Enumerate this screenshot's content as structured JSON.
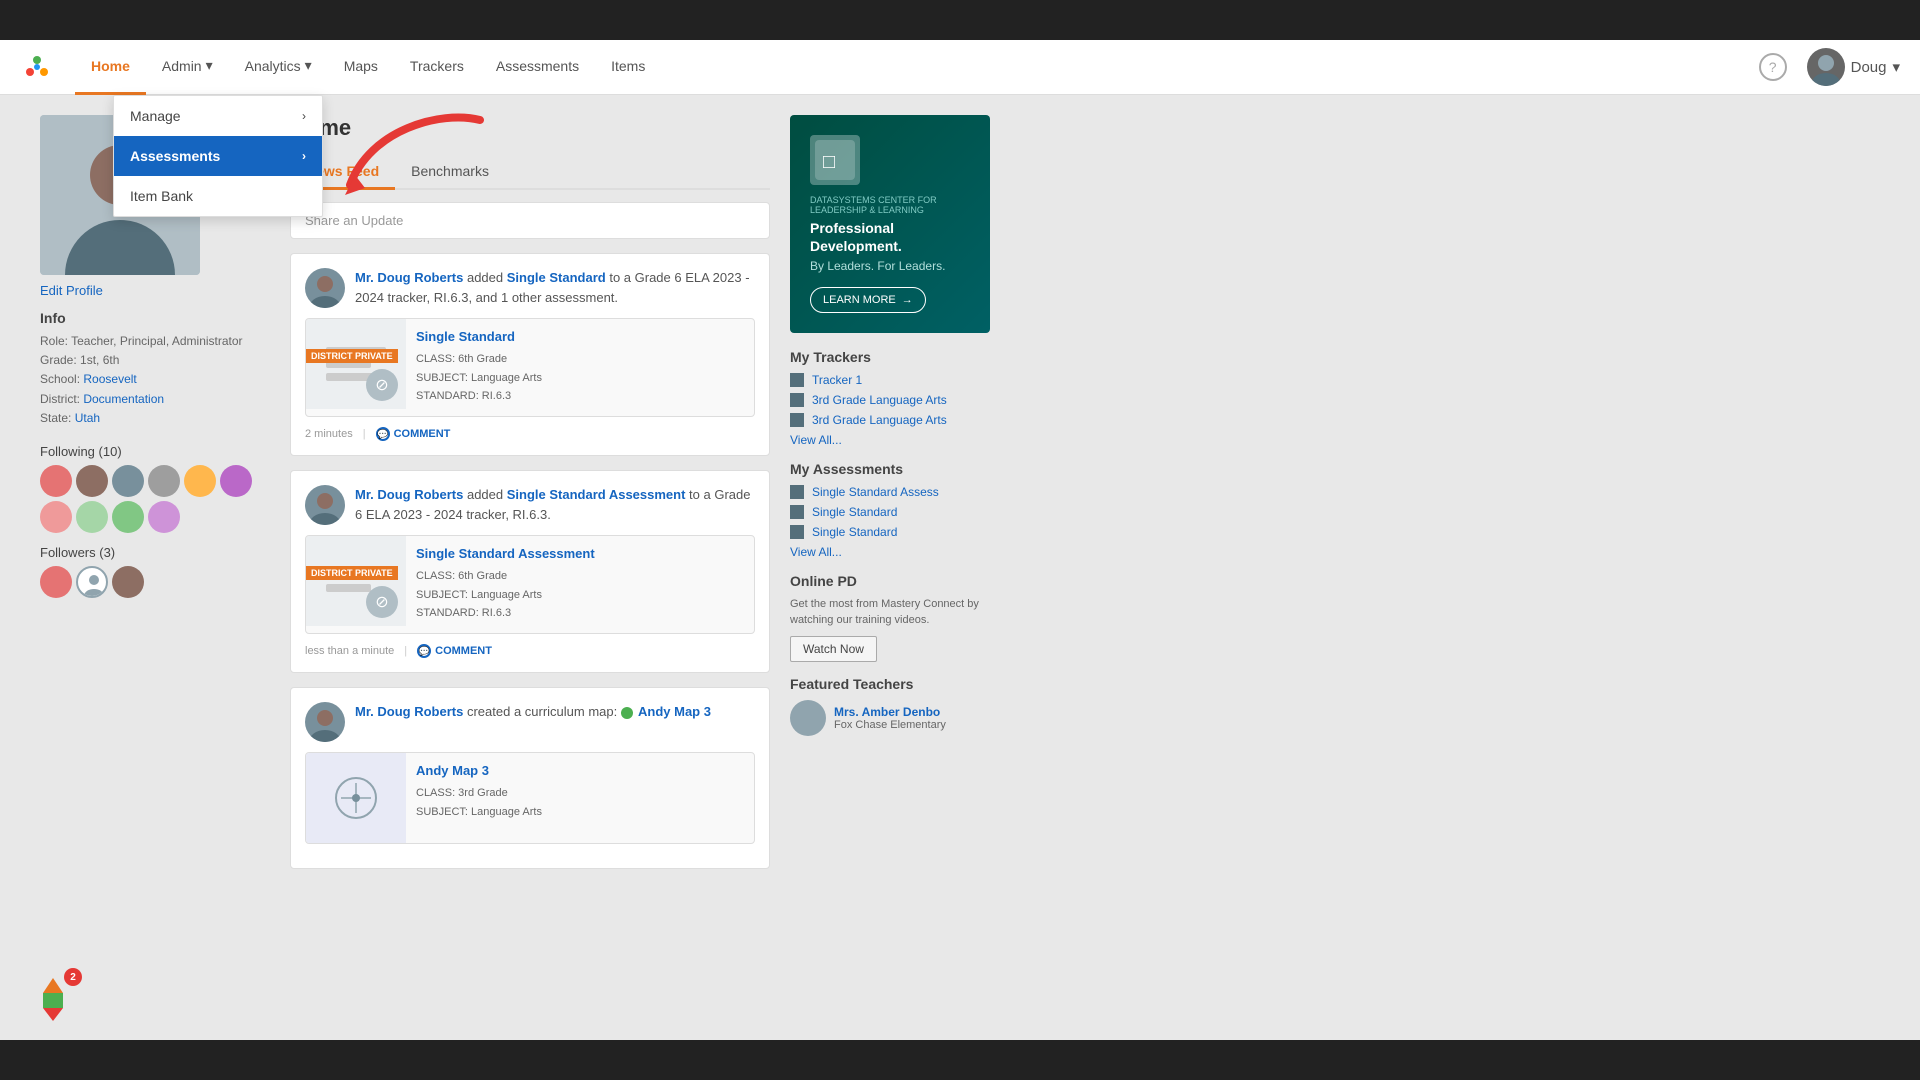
{
  "topbar": {},
  "navbar": {
    "logo_text": "MC",
    "items": [
      {
        "label": "Home",
        "active": true
      },
      {
        "label": "Admin",
        "hasDropdown": true
      },
      {
        "label": "Analytics",
        "hasDropdown": true
      },
      {
        "label": "Maps"
      },
      {
        "label": "Trackers"
      },
      {
        "label": "Assessments"
      },
      {
        "label": "Items"
      }
    ],
    "help_label": "?",
    "user_label": "Doug",
    "user_chevron": "▾"
  },
  "admin_dropdown": {
    "items": [
      {
        "label": "Manage",
        "hasArrow": true,
        "highlighted": false
      },
      {
        "label": "Assessments",
        "hasArrow": true,
        "highlighted": true
      },
      {
        "label": "Item Bank",
        "hasArrow": false,
        "highlighted": false
      }
    ]
  },
  "page": {
    "title": "Home"
  },
  "feed": {
    "tabs": [
      {
        "label": "News Feed",
        "active": true
      },
      {
        "label": "Benchmarks",
        "active": false
      }
    ],
    "share_placeholder": "Share an Update",
    "items": [
      {
        "user": "Mr. Doug Roberts",
        "action": "added",
        "item_name": "Single Standard",
        "item_link": "Single Standard",
        "suffix": "to a Grade 6 ELA 2023 - 2024 tracker, RI.6.3, and 1 other assessment.",
        "card_title": "Single Standard",
        "card_class": "CLASS: 6th Grade",
        "card_subject": "SUBJECT: Language Arts",
        "card_standard": "STANDARD: RI.6.3",
        "badge": "DISTRICT PRIVATE",
        "time": "2 minutes",
        "comment_label": "COMMENT"
      },
      {
        "user": "Mr. Doug Roberts",
        "action": "added",
        "item_name": "Single Standard Assessment",
        "item_link": "Single Standard Assessment",
        "suffix": "to a Grade 6 ELA 2023 - 2024 tracker, RI.6.3.",
        "card_title": "Single Standard Assessment",
        "card_class": "CLASS: 6th Grade",
        "card_subject": "SUBJECT: Language Arts",
        "card_standard": "STANDARD: RI.6.3",
        "badge": "DISTRICT PRIVATE",
        "time": "less than a minute",
        "comment_label": "COMMENT"
      },
      {
        "user": "Mr. Doug Roberts",
        "action": "created a curriculum map:",
        "item_name": "Andy Map 3",
        "item_link": "Andy Map 3",
        "suffix": "",
        "card_title": "Andy Map 3",
        "card_class": "CLASS: 3rd Grade",
        "card_subject": "SUBJECT: Language Arts",
        "card_standard": "",
        "badge": "",
        "time": "",
        "comment_label": ""
      }
    ]
  },
  "right_panel": {
    "ad": {
      "org": "DATASYSTEMS CENTER FOR LEADERSHIP & LEARNING",
      "title": "Professional Development.",
      "subtitle": "By Leaders. For Leaders.",
      "btn_label": "LEARN MORE",
      "btn_arrow": "→"
    },
    "trackers": {
      "title": "My Trackers",
      "items": [
        {
          "label": "Tracker 1"
        },
        {
          "label": "3rd Grade Language Arts"
        },
        {
          "label": "3rd Grade Language Arts"
        }
      ],
      "view_all": "View All..."
    },
    "assessments": {
      "title": "My Assessments",
      "items": [
        {
          "label": "Single Standard Assess"
        },
        {
          "label": "Single Standard"
        },
        {
          "label": "Single Standard"
        }
      ],
      "view_all": "View All..."
    },
    "online_pd": {
      "title": "Online PD",
      "description": "Get the most from Mastery Connect by watching our training videos.",
      "btn_label": "Watch Now"
    },
    "featured": {
      "title": "Featured Teachers",
      "items": [
        {
          "name": "Mrs. Amber Denbo",
          "school": "Fox Chase Elementary"
        }
      ]
    }
  },
  "profile": {
    "edit_label": "Edit Profile",
    "info_title": "Info",
    "role": "Role: Teacher, Principal, Administrator",
    "grade": "Grade: 1st, 6th",
    "school_label": "School:",
    "school_value": "Roosevelt",
    "district_label": "District:",
    "district_value": "Documentation",
    "state_label": "State:",
    "state_value": "Utah",
    "following_label": "Following (10)",
    "followers_label": "Followers (3)"
  },
  "floating_badge": {
    "count": "2"
  }
}
